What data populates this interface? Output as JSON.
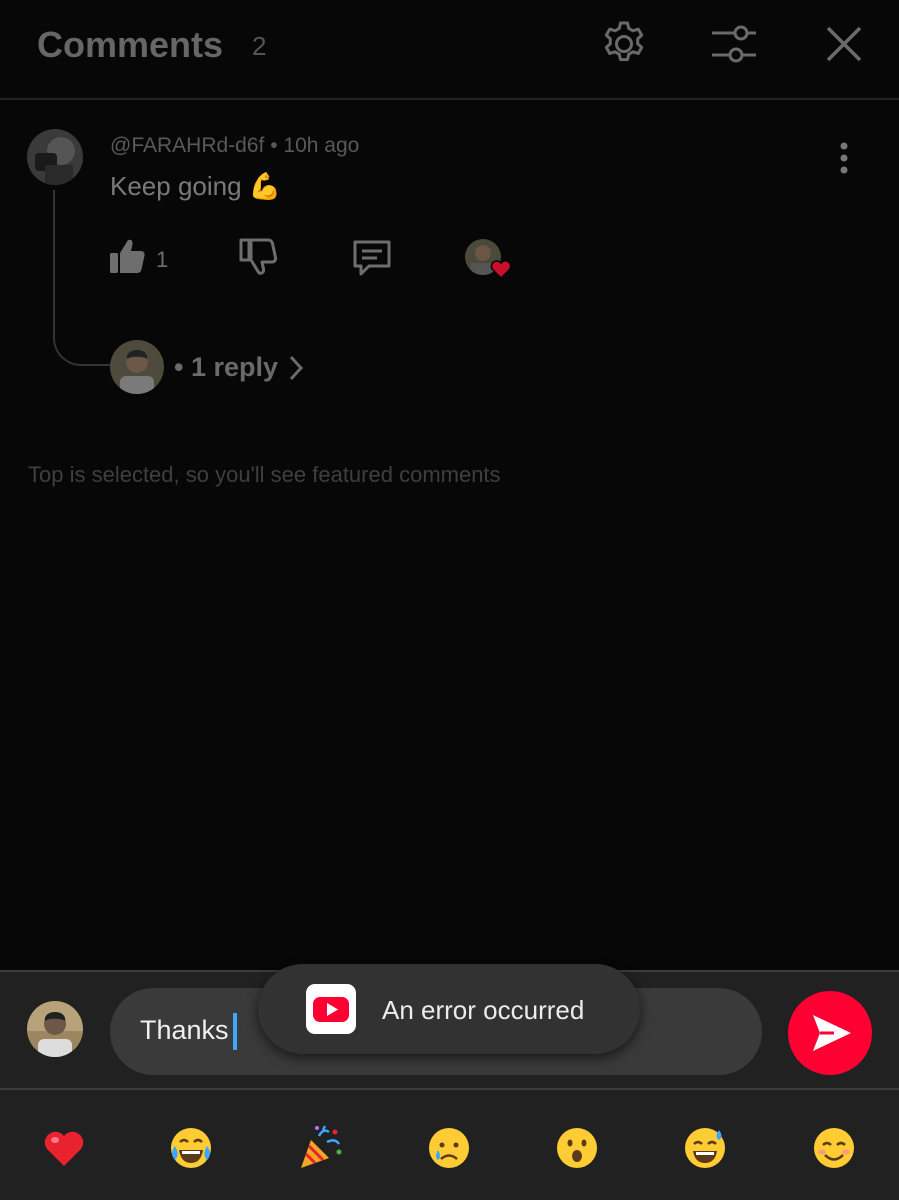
{
  "header": {
    "title": "Comments",
    "count": "2"
  },
  "comment": {
    "author": "@FARAHRd-d6f",
    "separator": " • ",
    "time": "10h ago",
    "text": "Keep going 💪",
    "like_count": "1",
    "replies_label": "• 1 reply"
  },
  "sort_note": "Top is selected, so you'll see featured comments",
  "composer": {
    "input_value": "Thanks"
  },
  "toast": {
    "message": "An error occurred"
  },
  "emoji_bar": [
    "❤️",
    "😂",
    "🎉",
    "😢",
    "😮",
    "😅",
    "😊"
  ],
  "colors": {
    "background": "#070707",
    "send_button": "#ff0033",
    "caret": "#3ea6ff",
    "toast": "#323232"
  }
}
